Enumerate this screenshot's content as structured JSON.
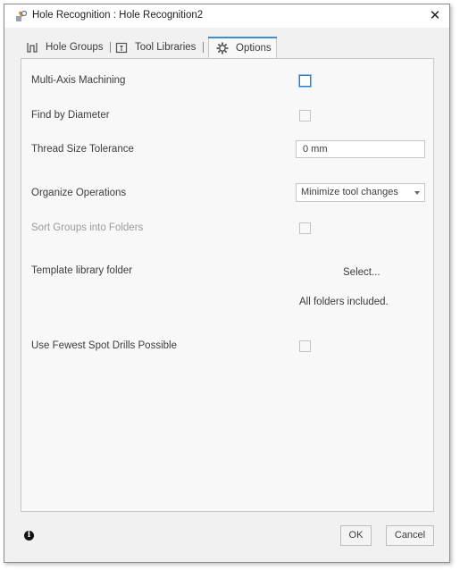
{
  "window": {
    "title": "Hole Recognition : Hole Recognition2",
    "close_glyph": "✕"
  },
  "tabs": [
    {
      "label": "Hole Groups",
      "icon": "hole-groups-icon",
      "active": false
    },
    {
      "label": "Tool Libraries",
      "icon": "tool-library-icon",
      "active": false
    },
    {
      "label": "Options",
      "icon": "gear-icon",
      "active": true
    }
  ],
  "options": {
    "multi_axis": {
      "label": "Multi-Axis Machining",
      "checked": false,
      "focused": true
    },
    "find_by_diameter": {
      "label": "Find by Diameter",
      "checked": false
    },
    "thread_tolerance": {
      "label": "Thread Size Tolerance",
      "value": "0 mm"
    },
    "organize_operations": {
      "label": "Organize Operations",
      "value": "Minimize tool changes"
    },
    "sort_groups": {
      "label": "Sort Groups into Folders",
      "checked": false,
      "disabled": true
    },
    "template_folder": {
      "label": "Template library folder",
      "button": "Select...",
      "note": "All folders included."
    },
    "fewest_spot_drills": {
      "label": "Use Fewest Spot Drills Possible",
      "checked": false
    }
  },
  "footer": {
    "info_glyph": "i",
    "ok_label": "OK",
    "cancel_label": "Cancel"
  },
  "colors": {
    "accent": "#3a8fd6",
    "dialog_bg": "#f1f1f1",
    "panel_bg": "#f8f8f8"
  }
}
